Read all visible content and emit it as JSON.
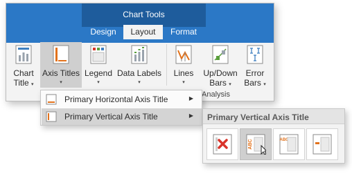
{
  "ribbon": {
    "contextual_title": "Chart Tools",
    "tabs": [
      {
        "label": "Design"
      },
      {
        "label": "Layout"
      },
      {
        "label": "Format"
      }
    ],
    "buttons": [
      {
        "label": "Chart\nTitle",
        "icon": "chart-title-icon"
      },
      {
        "label": "Axis Titles",
        "icon": "axis-titles-icon"
      },
      {
        "label": "Legend",
        "icon": "legend-icon"
      },
      {
        "label": "Data Labels",
        "icon": "data-labels-icon"
      },
      {
        "label": "Lines",
        "icon": "lines-icon"
      },
      {
        "label": "Up/Down\nBars",
        "icon": "up-down-bars-icon"
      },
      {
        "label": "Error\nBars",
        "icon": "error-bars-icon"
      }
    ],
    "group_label": "Analysis",
    "dropdown_arrow": "▾"
  },
  "axis_titles_menu": {
    "items": [
      {
        "label": "Primary Horizontal Axis Title",
        "icon": "horizontal-axis-title-icon",
        "submenu_arrow": "▶"
      },
      {
        "label": "Primary Vertical Axis Title",
        "icon": "vertical-axis-title-icon",
        "submenu_arrow": "▶"
      }
    ]
  },
  "vertical_axis_gallery": {
    "title": "Primary Vertical Axis Title",
    "options": [
      {
        "icon": "none-icon"
      },
      {
        "icon": "rotated-title-icon",
        "icon_text": "ABC"
      },
      {
        "icon": "vertical-title-icon",
        "icon_text": "ABC"
      },
      {
        "icon": "horizontal-title-icon"
      }
    ]
  },
  "colors": {
    "ribbon_blue": "#2b78c6",
    "contextual_blue": "#1e5c9c",
    "icon_orange": "#e2721c",
    "icon_red": "#d9342b",
    "icon_green": "#5a9e3c",
    "icon_blue": "#3f7fbf"
  }
}
